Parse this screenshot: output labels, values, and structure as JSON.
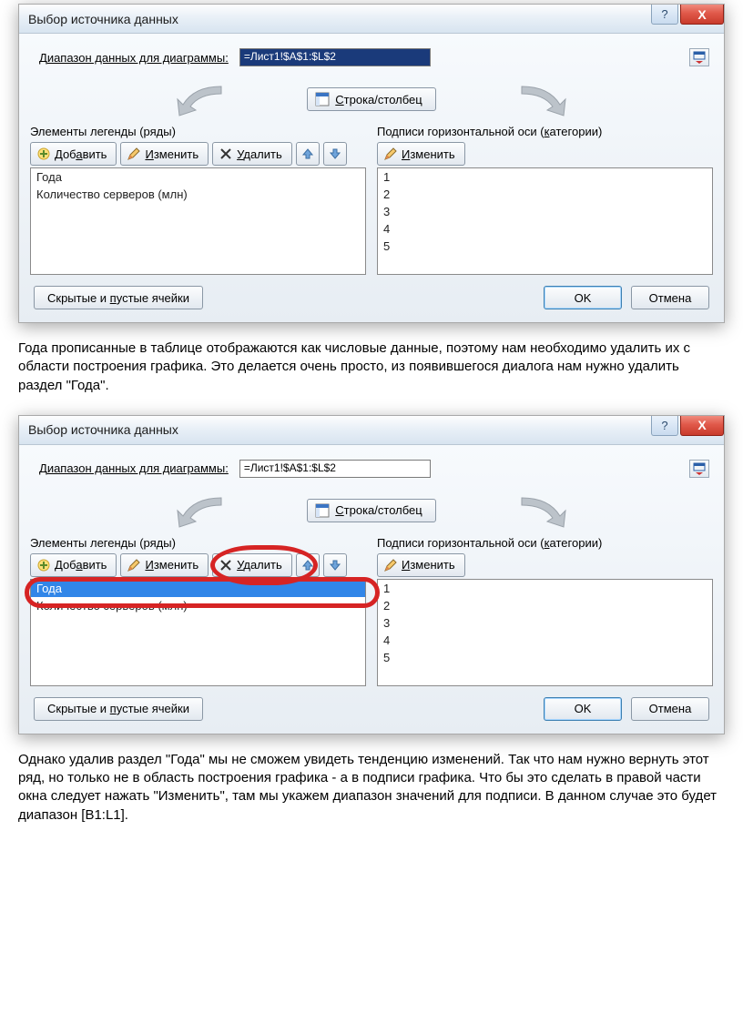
{
  "dialog1": {
    "title": "Выбор источника данных",
    "help": "?",
    "close": "X",
    "range_label_pre": "Д",
    "range_label": "иапазон данных для диаграммы:",
    "range_value": "=Лист1!$A$1:$L$2",
    "swap_label_u": "С",
    "swap_label": "трока/столбец",
    "legend_header": "Элементы легенды (ряды)",
    "add_u": "а",
    "add_pre": "Доб",
    "add_post": "вить",
    "edit_u": "И",
    "edit_post": "зменить",
    "del_u": "У",
    "del_post": "далить",
    "cat_header_pre": "Подписи горизонтальной оси (",
    "cat_header_u": "к",
    "cat_header_post": "атегории)",
    "edit2_u": "И",
    "edit2_post": "зменить",
    "series": [
      "Года",
      "Количество серверов (млн)"
    ],
    "categories": [
      "1",
      "2",
      "3",
      "4",
      "5"
    ],
    "hidden_btn_pre": "Скрытые и ",
    "hidden_btn_u": "п",
    "hidden_btn_post": "устые ячейки",
    "ok": "OK",
    "cancel": "Отмена"
  },
  "paragraph1": "Года прописанные в таблице отображаются как числовые данные, поэтому нам необходимо удалить их с области построения графика. Это делается очень просто, из появившегося диалога нам нужно удалить раздел \"Года\".",
  "paragraph2": "Однако удалив раздел \"Года\" мы не сможем увидеть тенденцию изменений. Так что нам нужно вернуть этот ряд, но только не в область построения графика - а в подписи графика. Что бы это сделать в правой части окна следует нажать \"Изменить\", там мы укажем диапазон значений для подписи. В данном случае это будет диапазон [B1:L1]."
}
